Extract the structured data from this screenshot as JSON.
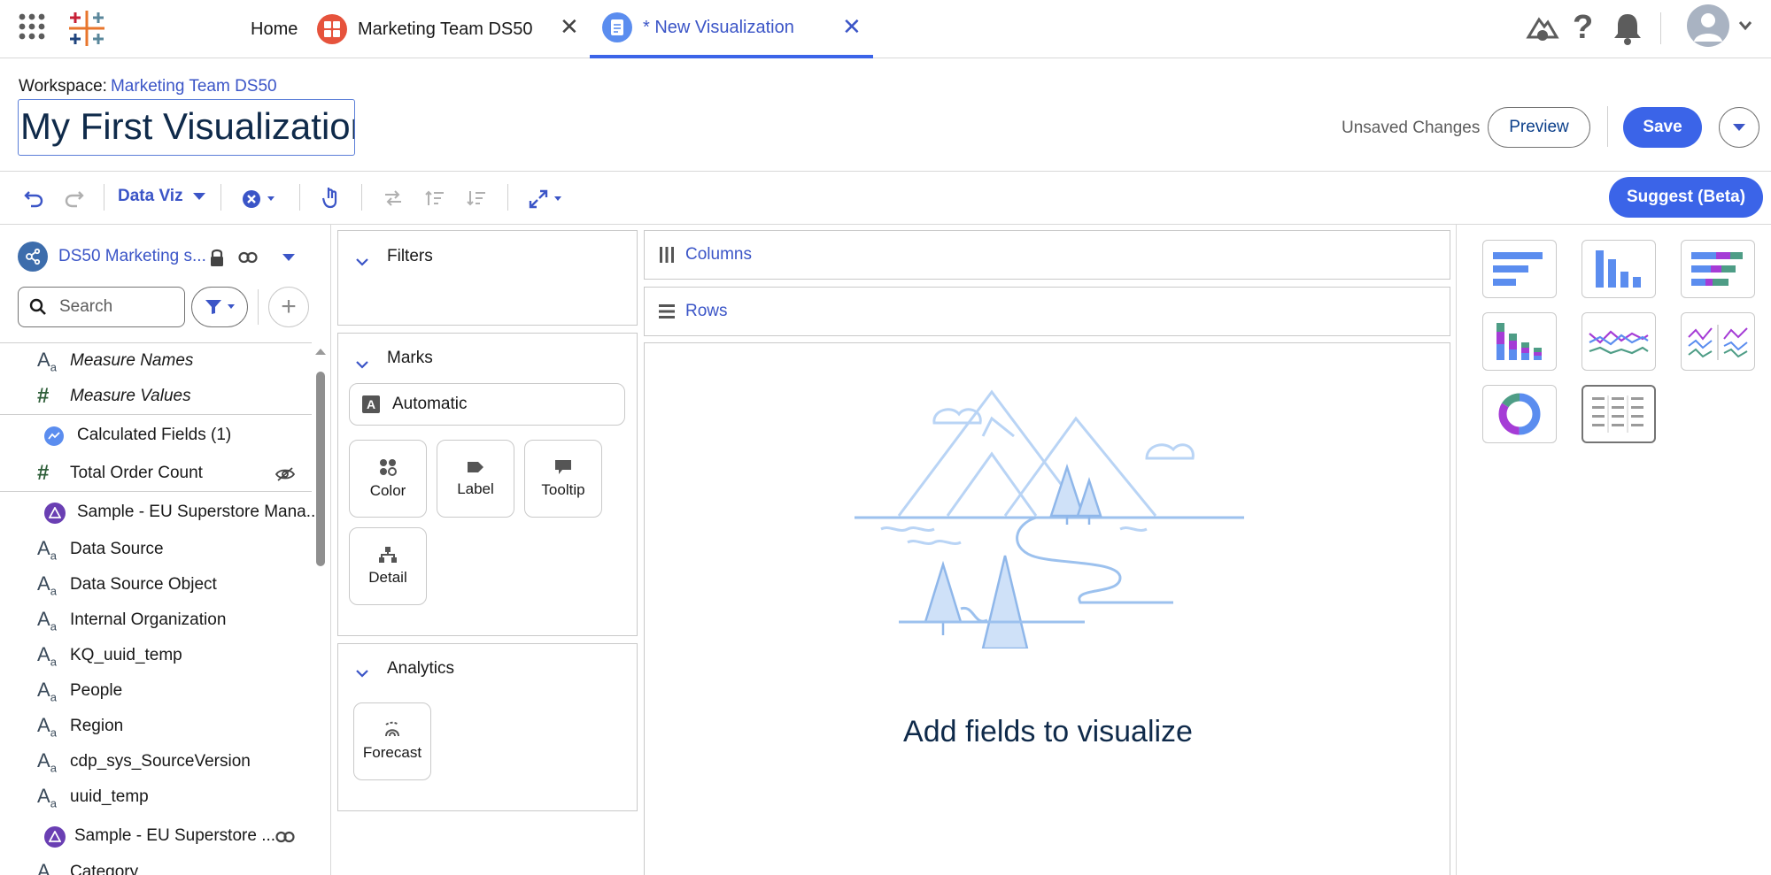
{
  "nav": {
    "home": "Home",
    "tabs": [
      {
        "label": "Marketing Team DS50"
      },
      {
        "label": "* New Visualization"
      }
    ]
  },
  "header": {
    "workspace_prefix": "Workspace:",
    "workspace_link": "Marketing Team DS50",
    "title": "My First Visualization",
    "status": "Unsaved Changes",
    "preview": "Preview",
    "save": "Save"
  },
  "toolbar": {
    "data_viz": "Data Viz",
    "suggest": "Suggest (Beta)"
  },
  "left": {
    "datasource": "DS50 Marketing s...",
    "search_placeholder": "Search",
    "fields": [
      {
        "label": "Measure Names",
        "icon": "Aa",
        "italic": true
      },
      {
        "label": "Measure Values",
        "icon": "#",
        "italic": true
      },
      {
        "label": "Calculated Fields (1)",
        "icon": "calc"
      },
      {
        "label": "Total Order Count",
        "icon": "#"
      },
      {
        "label": "Sample - EU Superstore Mana...",
        "icon": "obj"
      },
      {
        "label": "Data Source",
        "icon": "Aa"
      },
      {
        "label": "Data Source Object",
        "icon": "Aa"
      },
      {
        "label": "Internal Organization",
        "icon": "Aa"
      },
      {
        "label": "KQ_uuid_temp",
        "icon": "Aa"
      },
      {
        "label": "People",
        "icon": "Aa"
      },
      {
        "label": "Region",
        "icon": "Aa"
      },
      {
        "label": "cdp_sys_SourceVersion",
        "icon": "Aa"
      },
      {
        "label": "uuid_temp",
        "icon": "Aa"
      },
      {
        "label": "Sample - EU Superstore ...",
        "icon": "obj"
      },
      {
        "label": "Category",
        "icon": "Aa"
      }
    ]
  },
  "panels": {
    "filters": "Filters",
    "marks": "Marks",
    "mark_type": "Automatic",
    "mark_buttons": [
      "Color",
      "Label",
      "Tooltip",
      "Detail"
    ],
    "analytics": "Analytics",
    "forecast": "Forecast"
  },
  "shelves": {
    "columns": "Columns",
    "rows": "Rows"
  },
  "canvas": {
    "empty_message": "Add fields to visualize"
  },
  "colors": {
    "brand": "#3b64e8",
    "link": "#3b55c7",
    "viz_blue": "#5b8def",
    "viz_purple": "#a53cd6",
    "viz_teal": "#4e9d86"
  }
}
